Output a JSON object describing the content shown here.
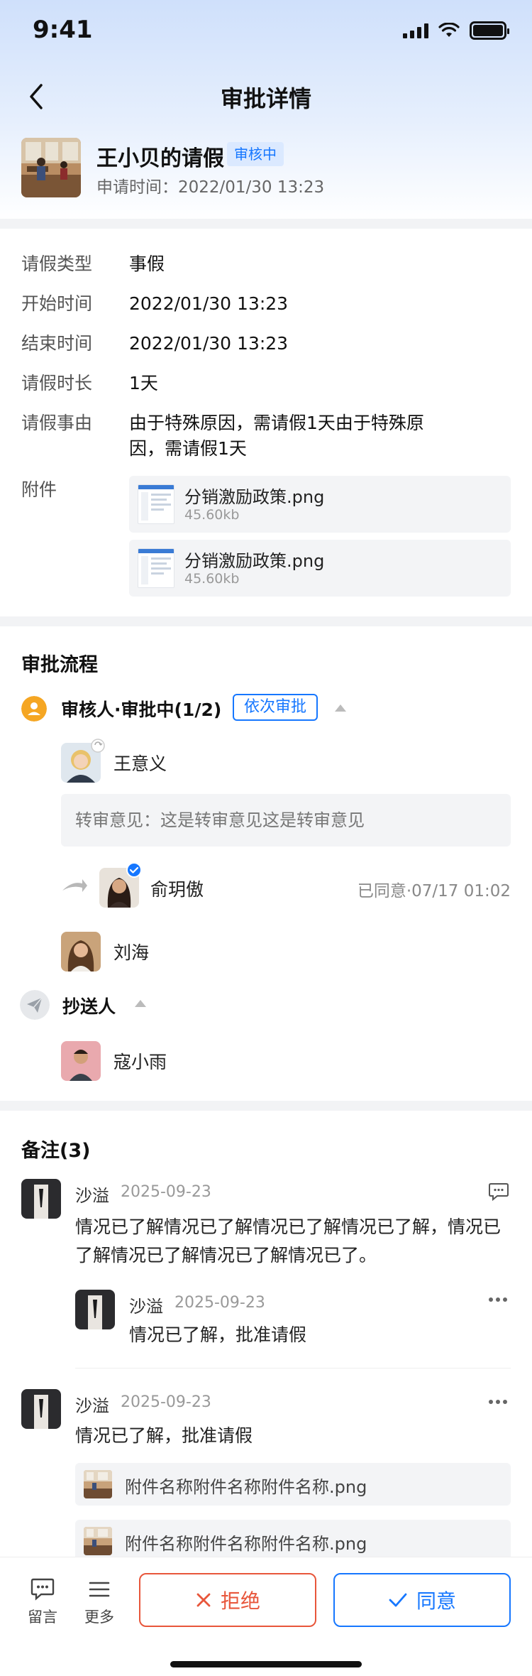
{
  "status_bar": {
    "time": "9:41"
  },
  "nav": {
    "title": "审批详情"
  },
  "applicant": {
    "title": "王小贝的请假",
    "status_badge": "审核中",
    "apply_time": "申请时间：2022/01/30 13:23"
  },
  "details": [
    {
      "key": "请假类型",
      "value": "事假"
    },
    {
      "key": "开始时间",
      "value": "2022/01/30 13:23"
    },
    {
      "key": "结束时间",
      "value": "2022/01/30 13:23"
    },
    {
      "key": "请假时长",
      "value": "1天"
    },
    {
      "key": "请假事由",
      "value": "由于特殊原因，需请假1天由于特殊原因，需请假1天"
    },
    {
      "key": "附件",
      "value": ""
    }
  ],
  "attachments": [
    {
      "name": "分销激励政策.png",
      "size": "45.60kb"
    },
    {
      "name": "分销激励政策.png",
      "size": "45.60kb"
    }
  ],
  "flow": {
    "title": "审批流程",
    "reviewer_step": {
      "label": "审核人·审批中(1/2)",
      "mode": "依次审批"
    },
    "reviewers": [
      {
        "name": "王意义"
      },
      {
        "name": "俞玥傲",
        "status": "已同意·07/17 01:02"
      },
      {
        "name": "刘海"
      }
    ],
    "transfer_opinion": "转审意见：这是转审意见这是转审意见",
    "cc_step": {
      "label": "抄送人"
    },
    "cc": [
      {
        "name": "寇小雨"
      }
    ]
  },
  "comments": {
    "title": "备注(3)",
    "items": [
      {
        "author": "沙溢",
        "date": "2025-09-23",
        "text": "情况已了解情况已了解情况已了解情况已了解，情况已了解情况已了解情况已了解情况已了。",
        "reply": {
          "author": "沙溢",
          "date": "2025-09-23",
          "text": "情况已了解，批准请假"
        }
      },
      {
        "author": "沙溢",
        "date": "2025-09-23",
        "text": "情况已了解，批准请假",
        "attachments": [
          {
            "name": "附件名称附件名称附件名称.png"
          },
          {
            "name": "附件名称附件名称附件名称.png"
          }
        ]
      }
    ]
  },
  "bottom": {
    "comment_label": "留言",
    "more_label": "更多",
    "reject_label": "拒绝",
    "agree_label": "同意"
  },
  "colors": {
    "accent": "#1677ff",
    "reject": "#e8563b",
    "step_icon": "#f5a623",
    "divider": "#f2f3f5"
  }
}
